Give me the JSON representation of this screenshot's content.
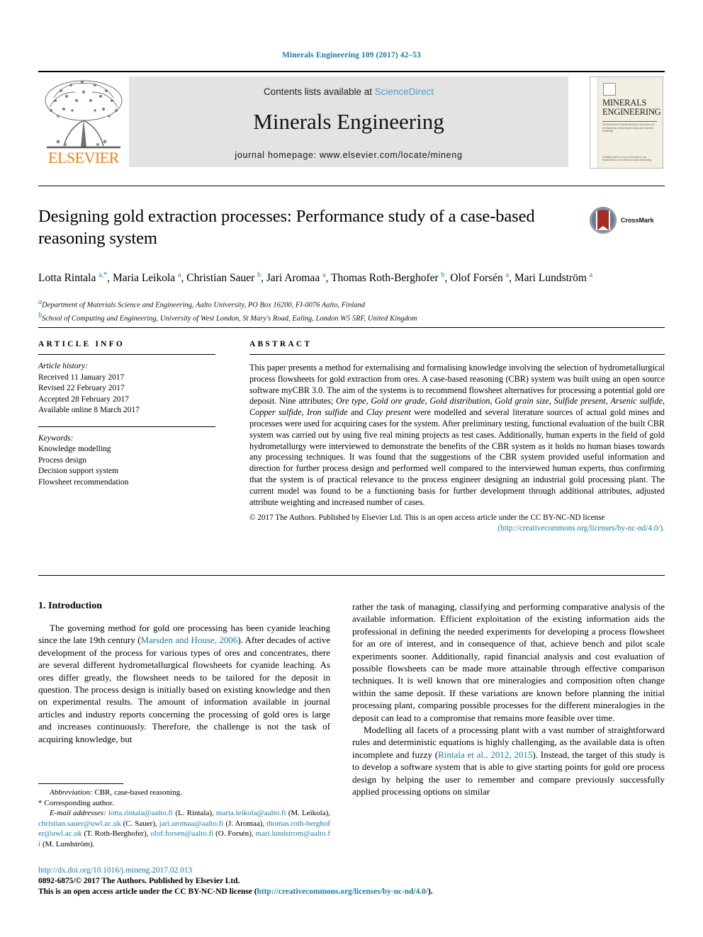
{
  "running_head": "Minerals Engineering 109 (2017) 42–53",
  "masthead": {
    "publisher_name": "ELSEVIER",
    "contents_prefix": "Contents lists available at ",
    "contents_link": "ScienceDirect",
    "journal_name": "Minerals Engineering",
    "homepage": "journal homepage: www.elsevier.com/locate/mineng",
    "cover": {
      "title_line1": "MINERALS",
      "title_line2": "ENGINEERING",
      "subtitle": "An International Journal devoted to innovation and developments in mineral processing and extractive metallurgy",
      "footer": "Available online at www.sciencedirect.com  ScienceDirect  www.elsevier.com/locate/mineng"
    }
  },
  "article": {
    "title": "Designing gold extraction processes: Performance study of a case-based reasoning system",
    "crossmark_label": "CrossMark",
    "authors_html": "Lotta Rintala <sup>a,*</sup>, Maria Leikola <sup>a</sup>, Christian Sauer <sup>b</sup>, Jari Aromaa <sup>a</sup>, Thomas Roth-Berghofer <sup>b</sup>, Olof Forsén <sup>a</sup>, Mari Lundström <sup>a</sup>",
    "affiliations": [
      {
        "marker": "a",
        "text": "Department of Materials Science and Engineering, Aalto University, PO Box 16200, FI-0076 Aalto, Finland"
      },
      {
        "marker": "b",
        "text": "School of Computing and Engineering, University of West London, St Mary's Road, Ealing, London W5 5RF, United Kingdom"
      }
    ]
  },
  "article_info": {
    "heading": "ARTICLE INFO",
    "history_label": "Article history:",
    "history": [
      "Received 11 January 2017",
      "Revised 22 February 2017",
      "Accepted 28 February 2017",
      "Available online 8 March 2017"
    ],
    "keywords_label": "Keywords:",
    "keywords": [
      "Knowledge modelling",
      "Process design",
      "Decision support system",
      "Flowsheet recommendation"
    ]
  },
  "abstract": {
    "heading": "ABSTRACT",
    "body_html": "This paper presents a method for externalising and formalising knowledge involving the selection of hydrometallurgical process flowsheets for gold extraction from ores. A case-based reasoning (CBR) system was built using an open source software myCBR 3.0. The aim of the systems is to recommend flowsheet alternatives for processing a potential gold ore deposit. Nine attributes; <i>Ore type</i>, <i>Gold ore grade</i>, <i>Gold distribution</i>, <i>Gold grain size</i>, <i>Sulfide present</i>, <i>Arsenic sulfide</i>, <i>Copper sulfide</i>, <i>Iron sulfide</i> and <i>Clay present</i> were modelled and several literature sources of actual gold mines and processes were used for acquiring cases for the system. After preliminary testing, functional evaluation of the built CBR system was carried out by using five real mining projects as test cases. Additionally, human experts in the field of gold hydrometallurgy were interviewed to demonstrate the benefits of the CBR system as it holds no human biases towards any processing techniques. It was found that the suggestions of the CBR system provided useful information and direction for further process design and performed well compared to the interviewed human experts, thus confirming that the system is of practical relevance to the process engineer designing an industrial gold processing plant. The current model was found to be a functioning basis for further development through additional attributes, adjusted attribute weighting and increased number of cases.",
    "copyright_text": "© 2017 The Authors. Published by Elsevier Ltd. This is an open access article under the CC BY-NC-ND license",
    "license_url": "(http://creativecommons.org/licenses/by-nc-nd/4.0/)."
  },
  "body": {
    "section_number_title": "1. Introduction",
    "left_paragraphs": [
      {
        "pre": "The governing method for gold ore processing has been cyanide leaching since the late 19th century (",
        "link": "Marsden and House, 2006",
        "post": "). After decades of active development of the process for various types of ores and concentrates, there are several different hydrometallurgical flowsheets for cyanide leaching. As ores differ greatly, the flowsheet needs to be tailored for the deposit in question. The process design is initially based on existing knowledge and then on experimental results. The amount of information available in journal articles and industry reports concerning the processing of gold ores is large and increases continuously. Therefore, the challenge is not the task of acquiring knowledge, but"
      }
    ],
    "right_paragraphs": [
      {
        "pre": "rather the task of managing, classifying and performing comparative analysis of the available information. Efficient exploitation of the existing information aids the professional in defining the needed experiments for developing a process flowsheet for an ore of interest, and in consequence of that, achieve bench and pilot scale experiments sooner. Additionally, rapid financial analysis and cost evaluation of possible flowsheets can be made more attainable through effective comparison techniques. It is well known that ore mineralogies and composition often change within the same deposit. If these variations are known before planning the initial processing plant, comparing possible processes for the different mineralogies in the deposit can lead to a compromise that remains more feasible over time.",
        "link": "",
        "post": "",
        "indent": false
      },
      {
        "pre": "Modelling all facets of a processing plant with a vast number of straightforward rules and deterministic equations is highly challenging, as the available data is often incomplete and fuzzy (",
        "link": "Rintala et al., 2012, 2015",
        "post": "). Instead, the target of this study is to develop a software system that is able to give starting points for gold ore process design by helping the user to remember and compare previously successfully applied processing options on similar",
        "indent": true
      }
    ]
  },
  "footnotes": {
    "abbreviation_label": "Abbreviation:",
    "abbreviation_text": "CBR, case-based reasoning.",
    "corresponding": "* Corresponding author.",
    "email_label": "E-mail addresses:",
    "emails": [
      {
        "address": "lotta.rintala@aalto.fi",
        "name": "(L. Rintala),"
      },
      {
        "address": "maria.leikola@aalto.fi",
        "name": "(M. Leikola),"
      },
      {
        "address": "christian.sauer@uwl.ac.uk",
        "name": "(C. Sauer),"
      },
      {
        "address": "jari.aromaa@aalto.fi",
        "name": "(J. Aromaa),"
      },
      {
        "address": "thomas.roth-berghofer@uwl.ac.uk",
        "name": "(T. Roth-Berghofer),"
      },
      {
        "address": "olof.forsen@aalto.fi",
        "name": "(O. Forsén),"
      },
      {
        "address": "mari.lundstrom@aalto.fi",
        "name": "(M. Lundström)."
      }
    ]
  },
  "footer": {
    "doi": "http://dx.doi.org/10.1016/j.mineng.2017.02.013",
    "issn_line": "0892-6875/© 2017 The Authors. Published by Elsevier Ltd.",
    "license_prefix": "This is an open access article under the CC BY-NC-ND license (",
    "license_link": "http://creativecommons.org/licenses/by-nc-nd/4.0/",
    "license_suffix": ")."
  },
  "colors": {
    "link_blue": "#1a7ba6",
    "sciencedirect_blue": "#4a9fd0",
    "elsevier_orange": "#ef7d1a",
    "masthead_gray": "#e3e3e3"
  }
}
